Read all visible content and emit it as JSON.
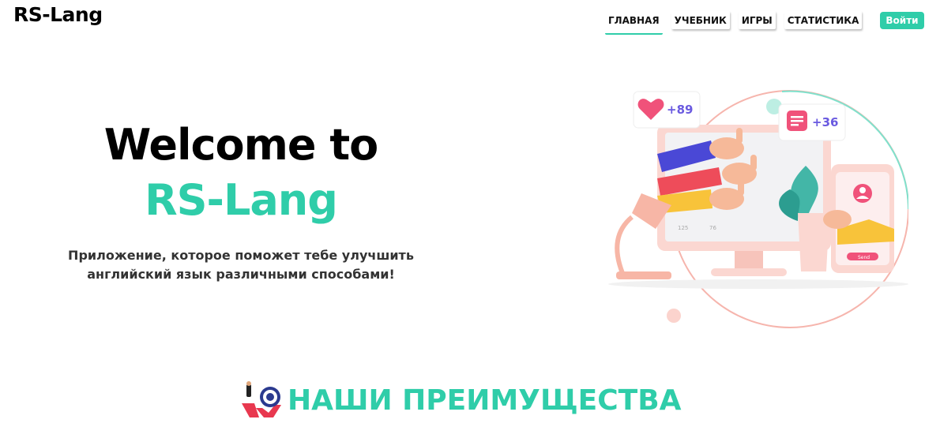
{
  "app": {
    "logo": "RS-Lang"
  },
  "nav": {
    "items": [
      {
        "label": "ГЛАВНАЯ",
        "active": true
      },
      {
        "label": "УЧЕБНИК",
        "active": false
      },
      {
        "label": "ИГРЫ",
        "active": false
      },
      {
        "label": "СТАТИСТИКА",
        "active": false
      }
    ],
    "login_label": "Войти"
  },
  "hero": {
    "title_line1": "Welcome to",
    "title_line2": "RS-Lang",
    "subtitle_line1": "Приложение, которое поможет тебе улучшить",
    "subtitle_line2": "английский язык различными способами!"
  },
  "illustration": {
    "likes_badge": "+89",
    "comments_badge": "+36",
    "post_likes": "125",
    "post_comments": "76",
    "phone_button": "Send"
  },
  "advantages": {
    "title": "НАШИ ПРЕИМУЩЕСТВА"
  },
  "colors": {
    "accent": "#2fcda9",
    "pink": "#f0527a",
    "purple": "#6a5ae0"
  },
  "icons": [
    "heart-icon",
    "message-icon",
    "user-icon",
    "target-icon"
  ]
}
